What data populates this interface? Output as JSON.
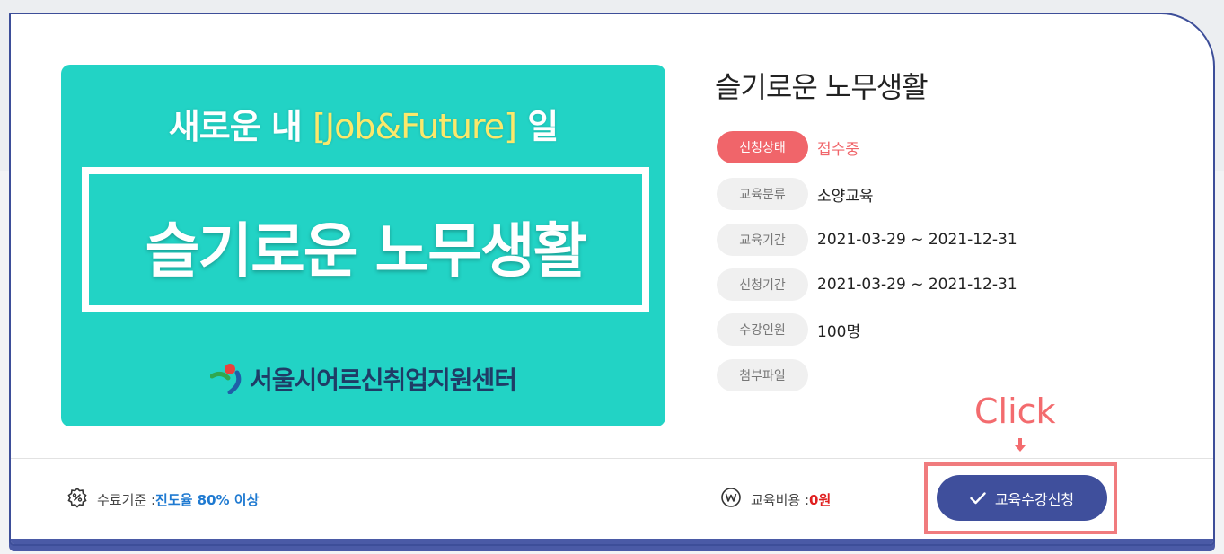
{
  "thumbnail": {
    "subtitle_pre": "새로운 내 ",
    "subtitle_highlight": "[Job&Future]",
    "subtitle_post": " 일",
    "title": "슬기로운 노무생활",
    "org": "서울시어르신취업지원센터"
  },
  "course": {
    "title": "슬기로운 노무생활",
    "rows": [
      {
        "label": "신청상태",
        "value": "접수중"
      },
      {
        "label": "교육분류",
        "value": "소양교육"
      },
      {
        "label": "교육기간",
        "value": "2021-03-29 ~ 2021-12-31"
      },
      {
        "label": "신청기간",
        "value": "2021-03-29 ~ 2021-12-31"
      },
      {
        "label": "수강인원",
        "value": "100명"
      },
      {
        "label": "첨부파일",
        "value": ""
      }
    ]
  },
  "footer": {
    "completion_label": "수료기준 : ",
    "completion_value": "진도율 80% 이상",
    "cost_label": "교육비용 : ",
    "cost_value": "0원",
    "apply_button": "교육수강신청"
  },
  "annotation": {
    "click_text": "Click"
  },
  "colors": {
    "accent": "#3f4f9c",
    "status": "#f0656a",
    "thumbnail_bg": "#22d3c5",
    "highlight": "#f07b7e"
  }
}
